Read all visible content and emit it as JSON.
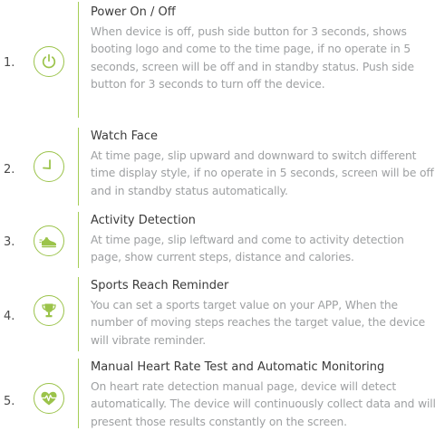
{
  "colors": {
    "accent": "#9bc34a",
    "title": "#3b3b3b",
    "body": "#9ea0a2"
  },
  "sections": [
    {
      "number": "1.",
      "icon": "power-icon",
      "title": "Power On / Off",
      "body": "When device is off, push side button for 3 seconds, shows booting logo and come to the time page, if no operate in 5 seconds, screen will be off and in standby status. Push side button for 3 seconds to turn off the device."
    },
    {
      "number": "2.",
      "icon": "clock-hands-icon",
      "title": "Watch Face",
      "body": "At time page, slip upward and downward to switch different time display style, if no operate in 5 seconds, screen will be off and in standby status automatically."
    },
    {
      "number": "3.",
      "icon": "shoe-icon",
      "title": "Activity Detection",
      "body": "At time page, slip leftward and come to activity detection page, show current steps, distance and calories."
    },
    {
      "number": "4.",
      "icon": "trophy-icon",
      "title": "Sports Reach Reminder",
      "body": "You can set a sports target value on your APP, When the number of moving steps reaches the target value, the device will vibrate reminder."
    },
    {
      "number": "5.",
      "icon": "heart-rate-icon",
      "title": "Manual Heart Rate Test and Automatic Monitoring",
      "body": "On heart rate detection manual page, device will detect automatically. The device will continuously collect data and will present those results constantly on the screen."
    }
  ]
}
